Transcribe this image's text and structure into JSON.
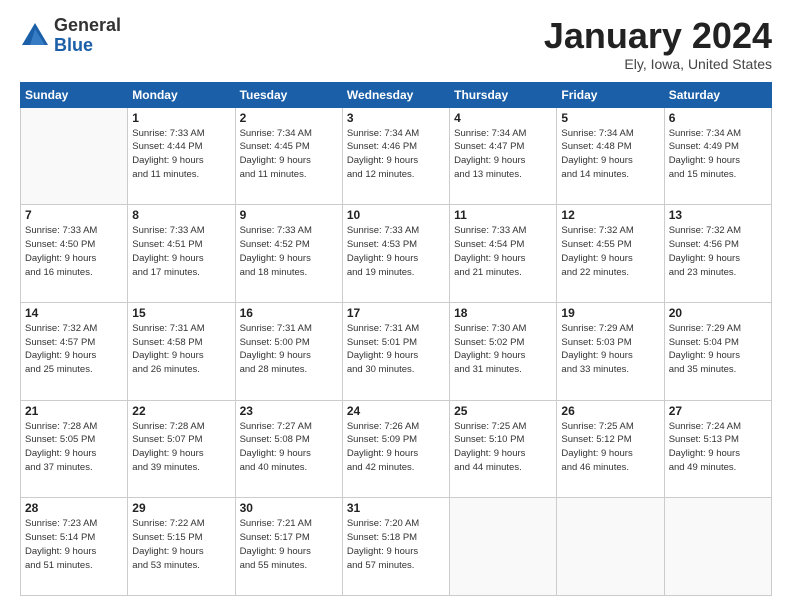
{
  "header": {
    "logo_general": "General",
    "logo_blue": "Blue",
    "month_title": "January 2024",
    "location": "Ely, Iowa, United States"
  },
  "days_of_week": [
    "Sunday",
    "Monday",
    "Tuesday",
    "Wednesday",
    "Thursday",
    "Friday",
    "Saturday"
  ],
  "weeks": [
    [
      {
        "day": "",
        "info": ""
      },
      {
        "day": "1",
        "info": "Sunrise: 7:33 AM\nSunset: 4:44 PM\nDaylight: 9 hours\nand 11 minutes."
      },
      {
        "day": "2",
        "info": "Sunrise: 7:34 AM\nSunset: 4:45 PM\nDaylight: 9 hours\nand 11 minutes."
      },
      {
        "day": "3",
        "info": "Sunrise: 7:34 AM\nSunset: 4:46 PM\nDaylight: 9 hours\nand 12 minutes."
      },
      {
        "day": "4",
        "info": "Sunrise: 7:34 AM\nSunset: 4:47 PM\nDaylight: 9 hours\nand 13 minutes."
      },
      {
        "day": "5",
        "info": "Sunrise: 7:34 AM\nSunset: 4:48 PM\nDaylight: 9 hours\nand 14 minutes."
      },
      {
        "day": "6",
        "info": "Sunrise: 7:34 AM\nSunset: 4:49 PM\nDaylight: 9 hours\nand 15 minutes."
      }
    ],
    [
      {
        "day": "7",
        "info": "Sunrise: 7:33 AM\nSunset: 4:50 PM\nDaylight: 9 hours\nand 16 minutes."
      },
      {
        "day": "8",
        "info": "Sunrise: 7:33 AM\nSunset: 4:51 PM\nDaylight: 9 hours\nand 17 minutes."
      },
      {
        "day": "9",
        "info": "Sunrise: 7:33 AM\nSunset: 4:52 PM\nDaylight: 9 hours\nand 18 minutes."
      },
      {
        "day": "10",
        "info": "Sunrise: 7:33 AM\nSunset: 4:53 PM\nDaylight: 9 hours\nand 19 minutes."
      },
      {
        "day": "11",
        "info": "Sunrise: 7:33 AM\nSunset: 4:54 PM\nDaylight: 9 hours\nand 21 minutes."
      },
      {
        "day": "12",
        "info": "Sunrise: 7:32 AM\nSunset: 4:55 PM\nDaylight: 9 hours\nand 22 minutes."
      },
      {
        "day": "13",
        "info": "Sunrise: 7:32 AM\nSunset: 4:56 PM\nDaylight: 9 hours\nand 23 minutes."
      }
    ],
    [
      {
        "day": "14",
        "info": "Sunrise: 7:32 AM\nSunset: 4:57 PM\nDaylight: 9 hours\nand 25 minutes."
      },
      {
        "day": "15",
        "info": "Sunrise: 7:31 AM\nSunset: 4:58 PM\nDaylight: 9 hours\nand 26 minutes."
      },
      {
        "day": "16",
        "info": "Sunrise: 7:31 AM\nSunset: 5:00 PM\nDaylight: 9 hours\nand 28 minutes."
      },
      {
        "day": "17",
        "info": "Sunrise: 7:31 AM\nSunset: 5:01 PM\nDaylight: 9 hours\nand 30 minutes."
      },
      {
        "day": "18",
        "info": "Sunrise: 7:30 AM\nSunset: 5:02 PM\nDaylight: 9 hours\nand 31 minutes."
      },
      {
        "day": "19",
        "info": "Sunrise: 7:29 AM\nSunset: 5:03 PM\nDaylight: 9 hours\nand 33 minutes."
      },
      {
        "day": "20",
        "info": "Sunrise: 7:29 AM\nSunset: 5:04 PM\nDaylight: 9 hours\nand 35 minutes."
      }
    ],
    [
      {
        "day": "21",
        "info": "Sunrise: 7:28 AM\nSunset: 5:05 PM\nDaylight: 9 hours\nand 37 minutes."
      },
      {
        "day": "22",
        "info": "Sunrise: 7:28 AM\nSunset: 5:07 PM\nDaylight: 9 hours\nand 39 minutes."
      },
      {
        "day": "23",
        "info": "Sunrise: 7:27 AM\nSunset: 5:08 PM\nDaylight: 9 hours\nand 40 minutes."
      },
      {
        "day": "24",
        "info": "Sunrise: 7:26 AM\nSunset: 5:09 PM\nDaylight: 9 hours\nand 42 minutes."
      },
      {
        "day": "25",
        "info": "Sunrise: 7:25 AM\nSunset: 5:10 PM\nDaylight: 9 hours\nand 44 minutes."
      },
      {
        "day": "26",
        "info": "Sunrise: 7:25 AM\nSunset: 5:12 PM\nDaylight: 9 hours\nand 46 minutes."
      },
      {
        "day": "27",
        "info": "Sunrise: 7:24 AM\nSunset: 5:13 PM\nDaylight: 9 hours\nand 49 minutes."
      }
    ],
    [
      {
        "day": "28",
        "info": "Sunrise: 7:23 AM\nSunset: 5:14 PM\nDaylight: 9 hours\nand 51 minutes."
      },
      {
        "day": "29",
        "info": "Sunrise: 7:22 AM\nSunset: 5:15 PM\nDaylight: 9 hours\nand 53 minutes."
      },
      {
        "day": "30",
        "info": "Sunrise: 7:21 AM\nSunset: 5:17 PM\nDaylight: 9 hours\nand 55 minutes."
      },
      {
        "day": "31",
        "info": "Sunrise: 7:20 AM\nSunset: 5:18 PM\nDaylight: 9 hours\nand 57 minutes."
      },
      {
        "day": "",
        "info": ""
      },
      {
        "day": "",
        "info": ""
      },
      {
        "day": "",
        "info": ""
      }
    ]
  ]
}
